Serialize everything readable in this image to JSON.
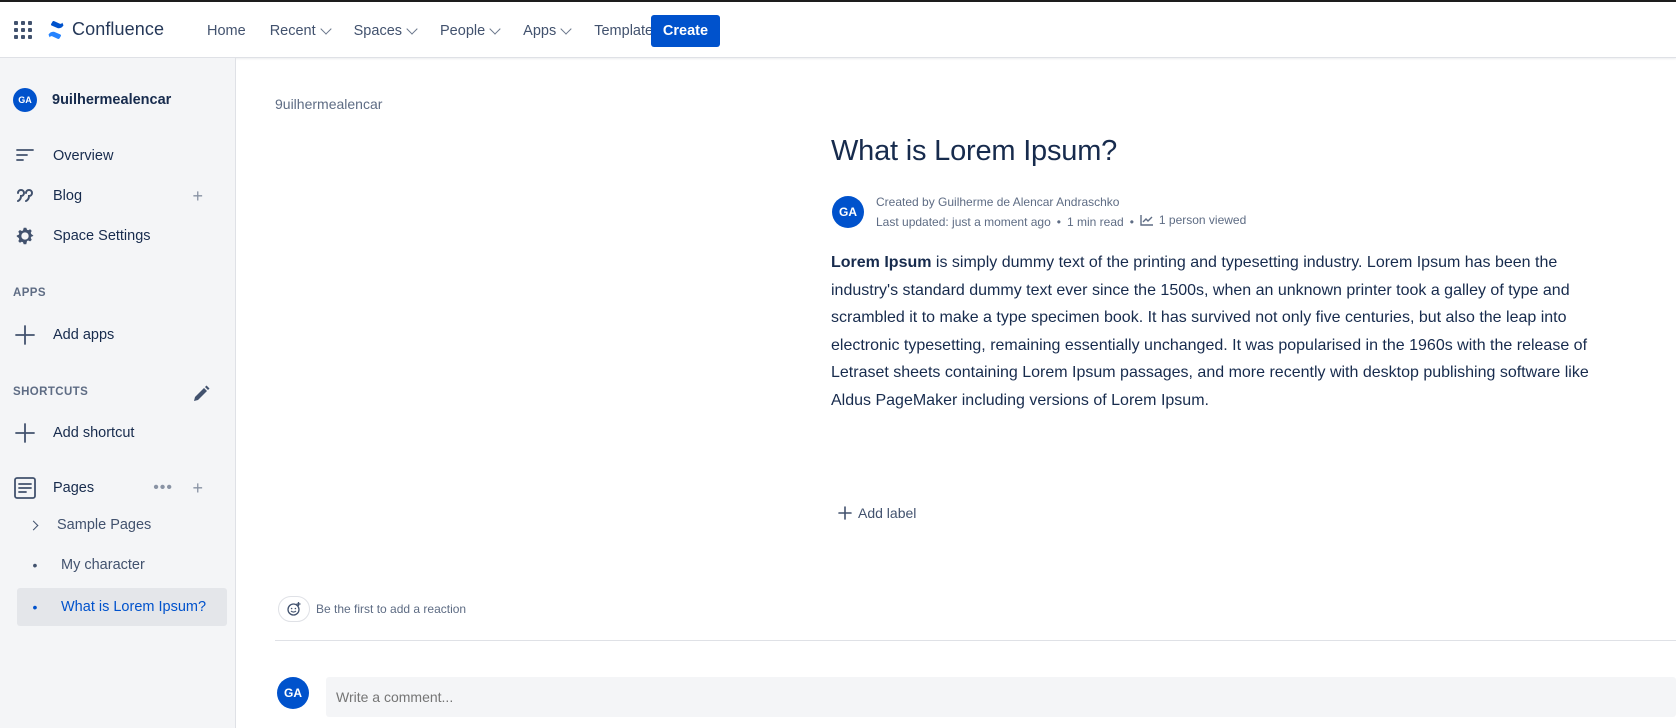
{
  "topbar": {
    "app_name": "Confluence",
    "nav": [
      {
        "label": "Home",
        "has_dropdown": false
      },
      {
        "label": "Recent",
        "has_dropdown": true
      },
      {
        "label": "Spaces",
        "has_dropdown": true
      },
      {
        "label": "People",
        "has_dropdown": true
      },
      {
        "label": "Apps",
        "has_dropdown": true
      },
      {
        "label": "Templates",
        "has_dropdown": false
      }
    ],
    "create_label": "Create",
    "accent": "#0052cc"
  },
  "sidebar": {
    "space_avatar": "GA",
    "space_name": "9uilhermealencar",
    "items": [
      {
        "label": "Overview",
        "icon": "overview-icon"
      },
      {
        "label": "Blog",
        "icon": "quote-icon"
      },
      {
        "label": "Space Settings",
        "icon": "gear-icon"
      }
    ],
    "apps_label": "APPS",
    "add_apps": "Add apps",
    "shortcuts_label": "SHORTCUTS",
    "add_shortcut": "Add shortcut",
    "pages_label": "Pages",
    "tree": [
      {
        "label": "Sample Pages",
        "type": "expandable"
      },
      {
        "label": "My character",
        "type": "leaf"
      },
      {
        "label": "What is Lorem Ipsum?",
        "type": "leaf",
        "active": true
      }
    ]
  },
  "main": {
    "breadcrumb": "9uilhermealencar",
    "title": "What is Lorem Ipsum?",
    "author_avatar": "GA",
    "created_by": "Created by Guilherme de Alencar Andraschko",
    "last_updated": "Last updated: just a moment ago",
    "read_time": "1 min read",
    "views": "1 person viewed",
    "body_bold": "Lorem Ipsum",
    "body_rest": " is simply dummy text of the printing and typesetting industry. Lorem Ipsum has been the industry's standard dummy text ever since the 1500s, when an unknown printer took a galley of type and scrambled it to make a type specimen book. It has survived not only five centuries, but also the leap into electronic typesetting, remaining essentially unchanged. It was popularised in the 1960s with the release of Letraset sheets containing Lorem Ipsum passages, and more recently with desktop publishing software like Aldus PageMaker including versions of Lorem Ipsum.",
    "add_label": "Add label",
    "reaction_text": "Be the first to add a reaction",
    "comment_avatar": "GA",
    "comment_placeholder": "Write a comment..."
  }
}
